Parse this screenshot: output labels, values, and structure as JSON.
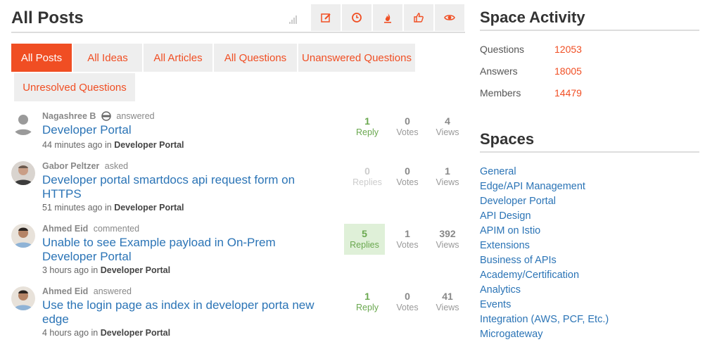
{
  "header": {
    "title": "All Posts"
  },
  "sort_buttons": [
    {
      "icon": "edit-icon"
    },
    {
      "icon": "clock-icon"
    },
    {
      "icon": "flame-icon"
    },
    {
      "icon": "thumbs-up-icon"
    },
    {
      "icon": "eye-icon"
    }
  ],
  "filters": [
    {
      "label": "All Posts",
      "active": true
    },
    {
      "label": "All Ideas"
    },
    {
      "label": "All Articles"
    },
    {
      "label": "All Questions"
    },
    {
      "label": "Unanswered Questions"
    },
    {
      "label": "Unresolved Questions"
    }
  ],
  "posts": [
    {
      "author": "Nagashree B",
      "action": "answered",
      "title": "Developer Portal",
      "time": "44 minutes ago",
      "in": "in",
      "space": "Developer Portal",
      "replies": {
        "num": "1",
        "label": "Reply"
      },
      "votes": {
        "num": "0",
        "label": "Votes"
      },
      "views": {
        "num": "4",
        "label": "Views"
      }
    },
    {
      "author": "Gabor Peltzer",
      "action": "asked",
      "title": "Developer portal smartdocs api request form on HTTPS",
      "time": "51 minutes ago",
      "in": "in",
      "space": "Developer Portal",
      "replies": {
        "num": "0",
        "label": "Replies"
      },
      "votes": {
        "num": "0",
        "label": "Votes"
      },
      "views": {
        "num": "1",
        "label": "Views"
      }
    },
    {
      "author": "Ahmed Eid",
      "action": "commented",
      "title": "Unable to see Example payload in On-Prem Developer Portal",
      "time": "3 hours ago",
      "in": "in",
      "space": "Developer Portal",
      "replies": {
        "num": "5",
        "label": "Replies"
      },
      "votes": {
        "num": "1",
        "label": "Votes"
      },
      "views": {
        "num": "392",
        "label": "Views"
      }
    },
    {
      "author": "Ahmed Eid",
      "action": "answered",
      "title": "Use the login page as index in developer porta new edge",
      "time": "4 hours ago",
      "in": "in",
      "space": "Developer Portal",
      "replies": {
        "num": "1",
        "label": "Reply"
      },
      "votes": {
        "num": "0",
        "label": "Votes"
      },
      "views": {
        "num": "41",
        "label": "Views"
      }
    }
  ],
  "activity": {
    "title": "Space Activity",
    "rows": [
      {
        "label": "Questions",
        "value": "12053"
      },
      {
        "label": "Answers",
        "value": "18005"
      },
      {
        "label": "Members",
        "value": "14479"
      }
    ]
  },
  "spaces": {
    "title": "Spaces",
    "items": [
      "General",
      "Edge/API Management",
      "Developer Portal",
      "API Design",
      "APIM on Istio",
      "Extensions",
      "Business of APIs",
      "Academy/Certification",
      "Analytics",
      "Events",
      "Integration (AWS, PCF, Etc.)",
      "Microgateway"
    ]
  },
  "colors": {
    "accent": "#f04e23",
    "link": "#2b74b6",
    "green": "#6aa84f",
    "reply_highlight": "#dff0d8"
  }
}
